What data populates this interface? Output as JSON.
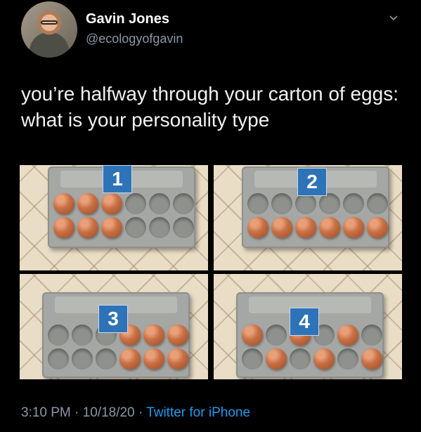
{
  "tweet": {
    "author_name": "Gavin Jones",
    "author_handle": "@ecologyofgavin",
    "text": "you’re halfway through your carton of eggs: what is your personality type",
    "time": "3:10 PM",
    "separator": "·",
    "date": "10/18/20",
    "source": "Twitter for iPhone"
  },
  "panels": [
    {
      "label": "1",
      "eggs": [
        1,
        1,
        1,
        0,
        0,
        0,
        1,
        1,
        1,
        0,
        0,
        0
      ]
    },
    {
      "label": "2",
      "eggs": [
        0,
        0,
        0,
        0,
        0,
        0,
        1,
        1,
        1,
        1,
        1,
        1
      ]
    },
    {
      "label": "3",
      "eggs": [
        0,
        0,
        0,
        1,
        1,
        1,
        0,
        0,
        0,
        1,
        1,
        1
      ]
    },
    {
      "label": "4",
      "eggs": [
        1,
        0,
        1,
        0,
        1,
        0,
        0,
        1,
        0,
        1,
        0,
        1
      ]
    }
  ],
  "colors": {
    "accent": "#1d9bf0",
    "badge": "#2e73b8",
    "meta": "#8b98a5"
  }
}
